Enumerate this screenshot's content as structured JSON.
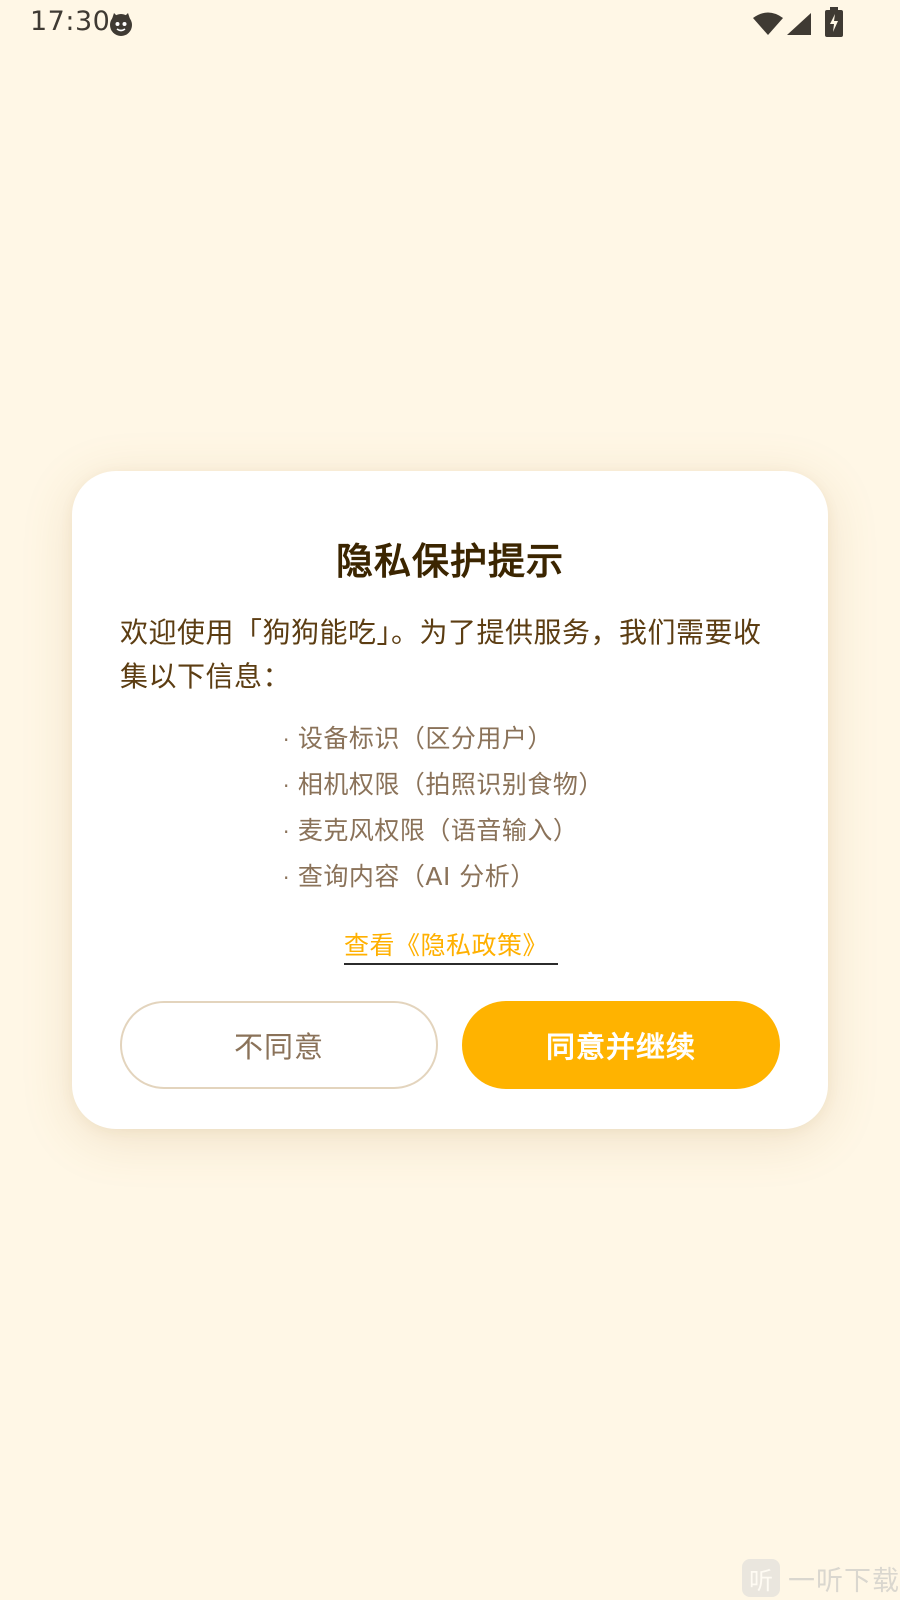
{
  "status_bar": {
    "time": "17:30",
    "icons": [
      "app-face-icon",
      "wifi-icon",
      "cell-signal-icon",
      "battery-charging-icon"
    ]
  },
  "dialog": {
    "title": "隐私保护提示",
    "intro": "欢迎使用「狗狗能吃」。为了提供服务，我们需要收集以下信息：",
    "bullet": "·",
    "items": [
      "设备标识（区分用户）",
      "相机权限（拍照识别食物）",
      "麦克风权限（语音输入）",
      "查询内容（AI 分析）"
    ],
    "policy_link": "查看《隐私政策》",
    "decline_label": "不同意",
    "accept_label": "同意并继续"
  },
  "colors": {
    "background": "#FFF7E6",
    "accent": "#FFB300",
    "title": "#3B2500",
    "body_text": "#5C3D12",
    "muted_text": "#8A7259"
  },
  "watermark": {
    "logo_glyph": "听",
    "text": "一听下载"
  }
}
